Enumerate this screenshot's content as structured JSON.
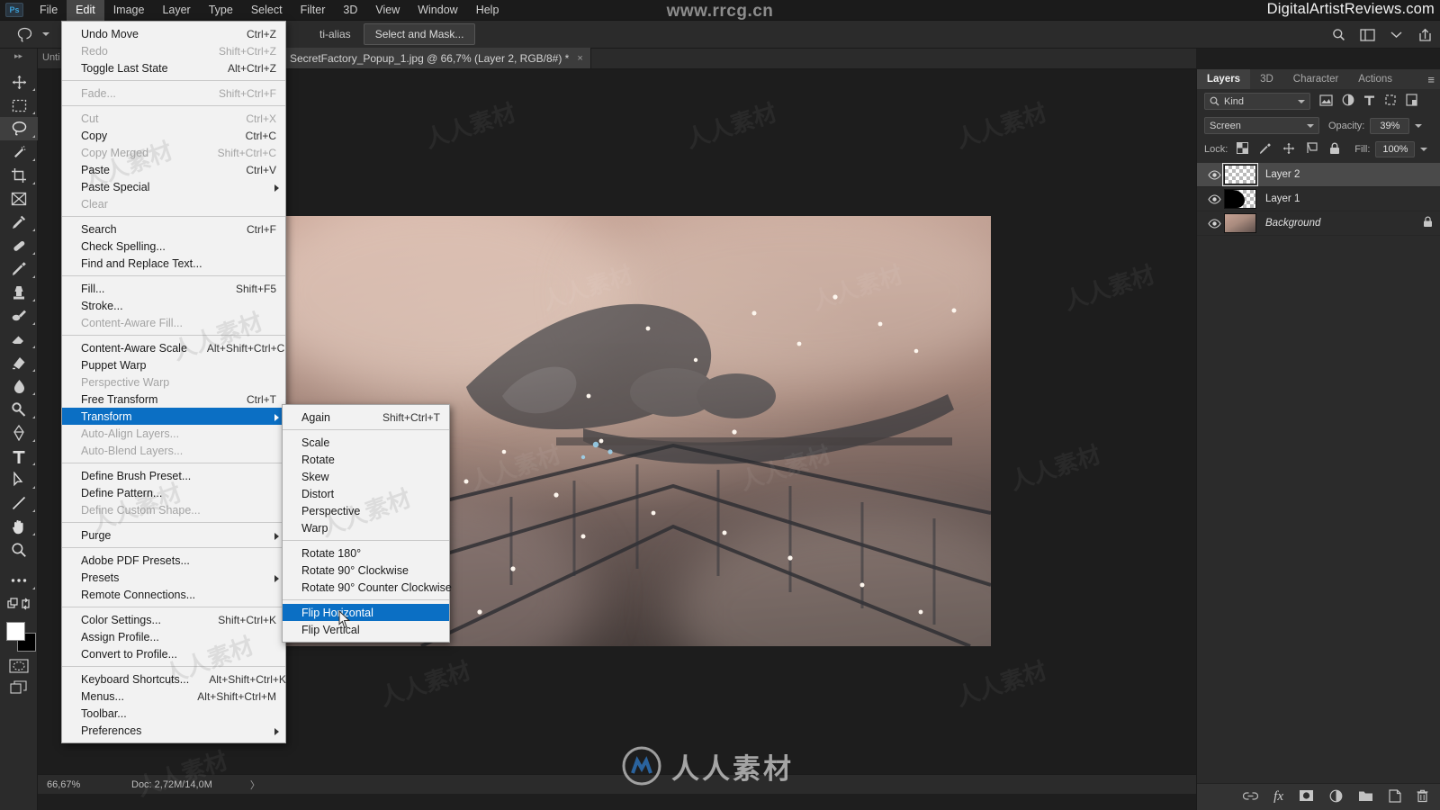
{
  "app": {
    "logo": "Ps",
    "watermark_top_center": "www.rrcg.cn",
    "watermark_top_right": "DigitalArtistReviews.com",
    "watermark_bottom": "人人素材"
  },
  "menubar": {
    "items": [
      {
        "label": "File",
        "active": false
      },
      {
        "label": "Edit",
        "active": true
      },
      {
        "label": "Image",
        "active": false
      },
      {
        "label": "Layer",
        "active": false
      },
      {
        "label": "Type",
        "active": false
      },
      {
        "label": "Select",
        "active": false
      },
      {
        "label": "Filter",
        "active": false
      },
      {
        "label": "3D",
        "active": false
      },
      {
        "label": "View",
        "active": false
      },
      {
        "label": "Window",
        "active": false
      },
      {
        "label": "Help",
        "active": false
      }
    ]
  },
  "options_bar": {
    "tool_icon": "lasso-icon",
    "antialias_label": "ti-alias",
    "select_and_mask_label": "Select and Mask...",
    "right_icons": [
      "search-icon",
      "workspace-icon",
      "chevron-down-icon",
      "share-icon"
    ]
  },
  "toolbar": {
    "collapse_label": "▸▸",
    "tools": [
      {
        "name": "move-tool",
        "selected": false
      },
      {
        "name": "rectangular-marquee-tool",
        "selected": false
      },
      {
        "name": "lasso-tool",
        "selected": true
      },
      {
        "name": "quick-selection-tool",
        "selected": false
      },
      {
        "name": "crop-tool",
        "selected": false
      },
      {
        "name": "frame-tool",
        "selected": false
      },
      {
        "name": "eyedropper-tool",
        "selected": false
      },
      {
        "name": "spot-healing-brush-tool",
        "selected": false
      },
      {
        "name": "brush-tool",
        "selected": false
      },
      {
        "name": "clone-stamp-tool",
        "selected": false
      },
      {
        "name": "history-brush-tool",
        "selected": false
      },
      {
        "name": "eraser-tool",
        "selected": false
      },
      {
        "name": "gradient-tool",
        "selected": false
      },
      {
        "name": "blur-tool",
        "selected": false
      },
      {
        "name": "dodge-tool",
        "selected": false
      },
      {
        "name": "pen-tool",
        "selected": false
      },
      {
        "name": "type-tool",
        "selected": false
      },
      {
        "name": "path-selection-tool",
        "selected": false
      },
      {
        "name": "line-shape-tool",
        "selected": false
      },
      {
        "name": "hand-tool",
        "selected": false
      },
      {
        "name": "zoom-tool",
        "selected": false
      },
      {
        "name": "more-tools",
        "selected": false
      }
    ],
    "foreground_color": "#ffffff",
    "background_color": "#000000"
  },
  "document": {
    "tab_title": "SecretFactory_Popup_1.jpg @ 66,7% (Layer 2, RGB/8#) *",
    "close_glyph": "×",
    "untitled_label": "Unti"
  },
  "status_bar": {
    "zoom": "66,67%",
    "doc_info": "Doc: 2,72M/14,0M",
    "arrow": "〉"
  },
  "edit_menu": {
    "groups": [
      [
        {
          "label": "Undo Move",
          "shortcut": "Ctrl+Z",
          "disabled": false
        },
        {
          "label": "Redo",
          "shortcut": "Shift+Ctrl+Z",
          "disabled": true
        },
        {
          "label": "Toggle Last State",
          "shortcut": "Alt+Ctrl+Z",
          "disabled": false
        }
      ],
      [
        {
          "label": "Fade...",
          "shortcut": "Shift+Ctrl+F",
          "disabled": true
        }
      ],
      [
        {
          "label": "Cut",
          "shortcut": "Ctrl+X",
          "disabled": true
        },
        {
          "label": "Copy",
          "shortcut": "Ctrl+C",
          "disabled": false
        },
        {
          "label": "Copy Merged",
          "shortcut": "Shift+Ctrl+C",
          "disabled": true
        },
        {
          "label": "Paste",
          "shortcut": "Ctrl+V",
          "disabled": false
        },
        {
          "label": "Paste Special",
          "shortcut": "",
          "disabled": false,
          "submenu": true
        },
        {
          "label": "Clear",
          "shortcut": "",
          "disabled": true
        }
      ],
      [
        {
          "label": "Search",
          "shortcut": "Ctrl+F",
          "disabled": false
        },
        {
          "label": "Check Spelling...",
          "shortcut": "",
          "disabled": false
        },
        {
          "label": "Find and Replace Text...",
          "shortcut": "",
          "disabled": false
        }
      ],
      [
        {
          "label": "Fill...",
          "shortcut": "Shift+F5",
          "disabled": false
        },
        {
          "label": "Stroke...",
          "shortcut": "",
          "disabled": false
        },
        {
          "label": "Content-Aware Fill...",
          "shortcut": "",
          "disabled": true
        }
      ],
      [
        {
          "label": "Content-Aware Scale",
          "shortcut": "Alt+Shift+Ctrl+C",
          "disabled": false
        },
        {
          "label": "Puppet Warp",
          "shortcut": "",
          "disabled": false
        },
        {
          "label": "Perspective Warp",
          "shortcut": "",
          "disabled": true
        },
        {
          "label": "Free Transform",
          "shortcut": "Ctrl+T",
          "disabled": false
        },
        {
          "label": "Transform",
          "shortcut": "",
          "disabled": false,
          "submenu": true,
          "highlighted": true
        },
        {
          "label": "Auto-Align Layers...",
          "shortcut": "",
          "disabled": true
        },
        {
          "label": "Auto-Blend Layers...",
          "shortcut": "",
          "disabled": true
        }
      ],
      [
        {
          "label": "Define Brush Preset...",
          "shortcut": "",
          "disabled": false
        },
        {
          "label": "Define Pattern...",
          "shortcut": "",
          "disabled": false
        },
        {
          "label": "Define Custom Shape...",
          "shortcut": "",
          "disabled": true
        }
      ],
      [
        {
          "label": "Purge",
          "shortcut": "",
          "disabled": false,
          "submenu": true
        }
      ],
      [
        {
          "label": "Adobe PDF Presets...",
          "shortcut": "",
          "disabled": false
        },
        {
          "label": "Presets",
          "shortcut": "",
          "disabled": false,
          "submenu": true
        },
        {
          "label": "Remote Connections...",
          "shortcut": "",
          "disabled": false
        }
      ],
      [
        {
          "label": "Color Settings...",
          "shortcut": "Shift+Ctrl+K",
          "disabled": false
        },
        {
          "label": "Assign Profile...",
          "shortcut": "",
          "disabled": false
        },
        {
          "label": "Convert to Profile...",
          "shortcut": "",
          "disabled": false
        }
      ],
      [
        {
          "label": "Keyboard Shortcuts...",
          "shortcut": "Alt+Shift+Ctrl+K",
          "disabled": false
        },
        {
          "label": "Menus...",
          "shortcut": "Alt+Shift+Ctrl+M",
          "disabled": false
        },
        {
          "label": "Toolbar...",
          "shortcut": "",
          "disabled": false
        },
        {
          "label": "Preferences",
          "shortcut": "",
          "disabled": false,
          "submenu": true
        }
      ]
    ]
  },
  "transform_menu": {
    "groups": [
      [
        {
          "label": "Again",
          "shortcut": "Shift+Ctrl+T",
          "disabled": false
        }
      ],
      [
        {
          "label": "Scale",
          "shortcut": "",
          "disabled": false
        },
        {
          "label": "Rotate",
          "shortcut": "",
          "disabled": false
        },
        {
          "label": "Skew",
          "shortcut": "",
          "disabled": false
        },
        {
          "label": "Distort",
          "shortcut": "",
          "disabled": false
        },
        {
          "label": "Perspective",
          "shortcut": "",
          "disabled": false
        },
        {
          "label": "Warp",
          "shortcut": "",
          "disabled": false
        }
      ],
      [
        {
          "label": "Rotate 180°",
          "shortcut": "",
          "disabled": false
        },
        {
          "label": "Rotate 90° Clockwise",
          "shortcut": "",
          "disabled": false
        },
        {
          "label": "Rotate 90° Counter Clockwise",
          "shortcut": "",
          "disabled": false
        }
      ],
      [
        {
          "label": "Flip Horizontal",
          "shortcut": "",
          "disabled": false,
          "highlighted": true
        },
        {
          "label": "Flip Vertical",
          "shortcut": "",
          "disabled": false
        }
      ]
    ]
  },
  "layers_panel": {
    "tabs": [
      {
        "label": "Layers",
        "active": true
      },
      {
        "label": "3D",
        "active": false
      },
      {
        "label": "Character",
        "active": false
      },
      {
        "label": "Actions",
        "active": false
      }
    ],
    "menu_glyph": "≡",
    "filter": {
      "kind_label": "Kind",
      "search_icon": "search-icon",
      "filter_icons": [
        "pixel-filter-icon",
        "adjustment-filter-icon",
        "type-filter-icon",
        "shape-filter-icon",
        "smartobject-filter-icon"
      ]
    },
    "blend_mode": "Screen",
    "opacity_label": "Opacity:",
    "opacity_value": "39%",
    "lock_label": "Lock:",
    "lock_icons": [
      "lock-transparent-pixels-icon",
      "lock-image-pixels-icon",
      "lock-position-icon",
      "lock-artboard-icon",
      "lock-all-icon"
    ],
    "fill_label": "Fill:",
    "fill_value": "100%",
    "layers": [
      {
        "name": "Layer 2",
        "visible": true,
        "selected": true,
        "thumb": "checker",
        "italic": false,
        "locked": false
      },
      {
        "name": "Layer 1",
        "visible": true,
        "selected": false,
        "thumb": "mixed",
        "italic": false,
        "locked": false
      },
      {
        "name": "Background",
        "visible": true,
        "selected": false,
        "thumb": "photo",
        "italic": true,
        "locked": true
      }
    ],
    "bottom_icons": [
      "link-layers-icon",
      "layer-style-fx-icon",
      "layer-mask-icon",
      "adjustment-layer-icon",
      "new-group-icon",
      "new-layer-icon",
      "delete-layer-icon"
    ]
  },
  "colors": {
    "highlight_blue": "#0b6fc4",
    "panel_bg": "#2b2b2b",
    "menu_bg": "#f2f2f2",
    "canvas_bg": "#1d1d1d"
  }
}
